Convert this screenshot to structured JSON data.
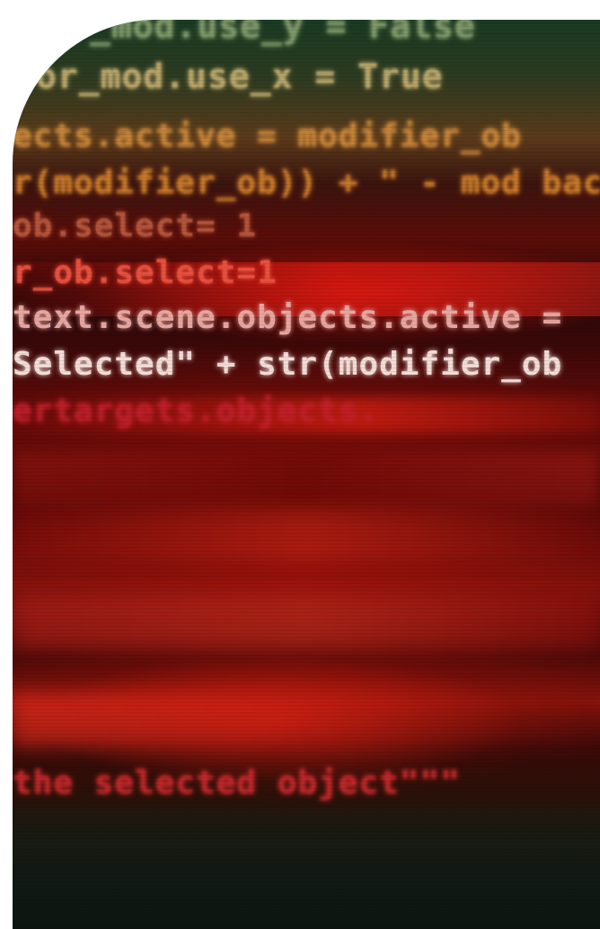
{
  "code_lines": [
    {
      "text": "_mod.use_y = False",
      "color": "#7f9a6a",
      "blur": "1.6px",
      "size": 38
    },
    {
      "text": "or_mod.use_x = True",
      "color": "#b8a56a",
      "blur": "1.2px",
      "size": 38
    },
    {
      "text": "ects.active = modifier_ob",
      "color": "#c9863a",
      "blur": "1.8px",
      "size": 36
    },
    {
      "text": "r(modifier_ob)) + \" - mod bac",
      "color": "#c97a2a",
      "blur": "1.6px",
      "size": 36
    },
    {
      "text": "ob.select= 1",
      "color": "#b3543a",
      "blur": "0.8px",
      "size": 36
    },
    {
      "text": "r_ob.select=1",
      "color": "#e8503e",
      "blur": "0.6px",
      "size": 36
    },
    {
      "text": "text.scene.objects.active =",
      "color": "#e6a6a0",
      "blur": "0.3px",
      "size": 36
    },
    {
      "text": "Selected\" + str(modifier_ob",
      "color": "#f1dcd6",
      "blur": "0.2px",
      "size": 36
    },
    {
      "text": "ertargets.objects. ",
      "color": "#c0202a",
      "blur": "2.2px",
      "size": 36
    },
    {
      "text": "the selected object\"\"\"",
      "color": "#c2282a",
      "blur": "1.8px",
      "size": 36
    }
  ],
  "colors": {
    "background": "#ffffff",
    "accent_red": "#e8503e",
    "accent_green": "#1a3a22"
  }
}
